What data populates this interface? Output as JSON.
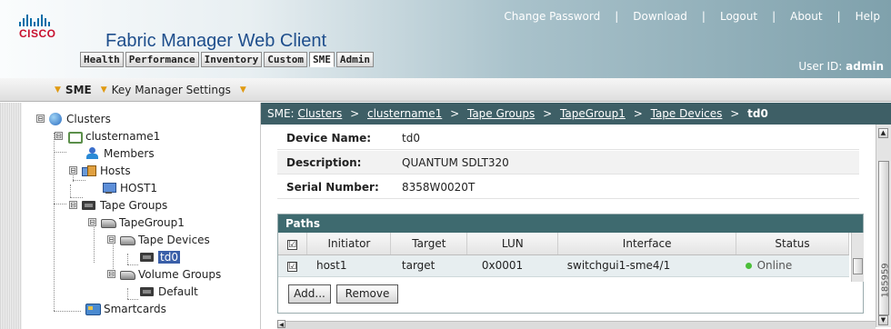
{
  "header": {
    "logo_text": "CISCO",
    "title": "Fabric Manager Web Client",
    "top_links": [
      "Change Password",
      "Download",
      "Logout",
      "About",
      "Help"
    ],
    "separator": "|",
    "tabs": [
      "Health",
      "Performance",
      "Inventory",
      "Custom",
      "SME",
      "Admin"
    ],
    "active_tab": "SME",
    "user_label": "User ID:",
    "user_name": "admin"
  },
  "subnav": {
    "items": [
      "SME",
      "Key Manager Settings"
    ]
  },
  "tree": {
    "items": [
      {
        "label": "Clusters",
        "icon": "globe-icon",
        "expander": "⊟"
      },
      {
        "label": "clustername1",
        "icon": "cluster-icon",
        "expander": "⊟"
      },
      {
        "label": "Members",
        "icon": "person-icon"
      },
      {
        "label": "Hosts",
        "icon": "hosts-icon",
        "expander": "⊟"
      },
      {
        "label": "HOST1",
        "icon": "host-icon"
      },
      {
        "label": "Tape Groups",
        "icon": "tape-icon",
        "expander": "⊟"
      },
      {
        "label": "TapeGroup1",
        "icon": "drive-icon",
        "expander": "⊟"
      },
      {
        "label": "Tape Devices",
        "icon": "drive-icon",
        "expander": "⊟"
      },
      {
        "label": "td0",
        "icon": "tape-icon",
        "selected": true
      },
      {
        "label": "Volume Groups",
        "icon": "drive-icon",
        "expander": "⊟"
      },
      {
        "label": "Default",
        "icon": "tape-icon"
      },
      {
        "label": "Smartcards",
        "icon": "smartcard-icon"
      }
    ]
  },
  "breadcrumb": {
    "prefix": "SME:",
    "links": [
      "Clusters",
      "clustername1",
      "Tape Groups",
      "TapeGroup1",
      "Tape Devices"
    ],
    "separator": ">",
    "current": "td0"
  },
  "properties": [
    {
      "label": "Device Name:",
      "value": "td0"
    },
    {
      "label": "Description:",
      "value": "QUANTUM SDLT320"
    },
    {
      "label": "Serial Number:",
      "value": "8358W0020T"
    }
  ],
  "paths": {
    "title": "Paths",
    "columns": [
      "Initiator",
      "Target",
      "LUN",
      "Interface",
      "Status"
    ],
    "rows": [
      {
        "checked": true,
        "initiator": "host1",
        "target": "target",
        "lun": "0x0001",
        "interface": "switchgui1-sme4/1",
        "status": "Online"
      }
    ],
    "header_checked": true,
    "check_glyph": "☑",
    "buttons": {
      "add": "Add...",
      "remove": "Remove"
    }
  },
  "status_colors": {
    "online": "#4bbf3a"
  },
  "doc_number": "185959"
}
